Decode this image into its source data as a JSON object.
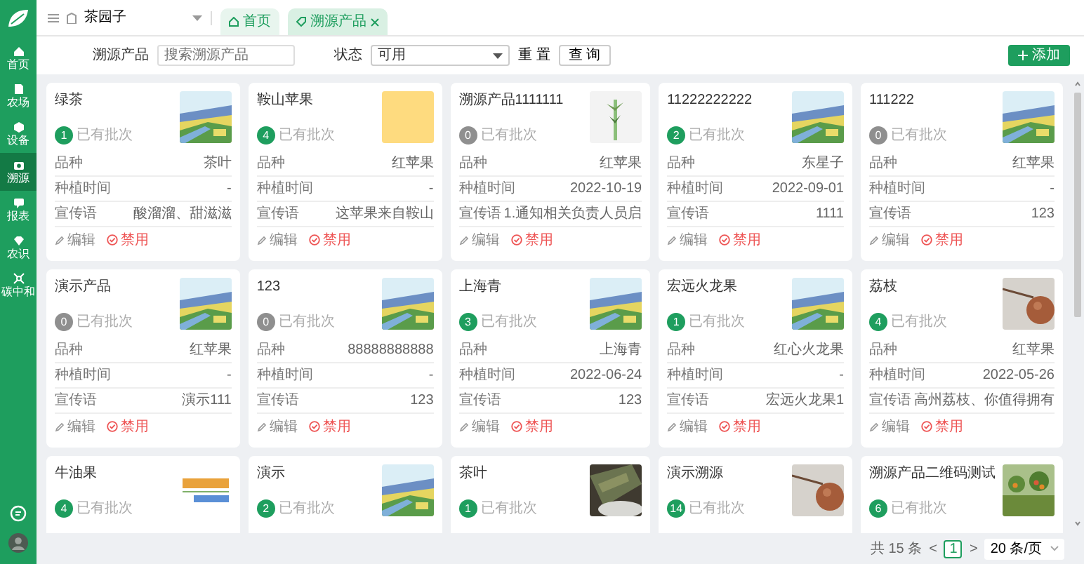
{
  "sidebar": {
    "items": [
      {
        "label": "首页",
        "selected": false
      },
      {
        "label": "农场",
        "selected": false
      },
      {
        "label": "设备",
        "selected": false
      },
      {
        "label": "溯源",
        "selected": true
      },
      {
        "label": "报表",
        "selected": false
      },
      {
        "label": "农识",
        "selected": false
      },
      {
        "label": "碳中和",
        "selected": false
      }
    ]
  },
  "header": {
    "farm_select": "茶园子",
    "tabs": [
      {
        "label": "首页",
        "selected": false,
        "closable": false
      },
      {
        "label": "溯源产品",
        "selected": true,
        "closable": true
      }
    ]
  },
  "filter": {
    "product_label": "溯源产品",
    "product_placeholder": "搜索溯源产品",
    "status_label": "状态",
    "status_value": "可用",
    "reset": "重 置",
    "query": "查 询",
    "add": "添加"
  },
  "cards": [
    {
      "title": "绿茶",
      "count": "1",
      "active": true,
      "count_label": "已有批次",
      "fields": [
        {
          "label": "品种",
          "value": "茶叶"
        },
        {
          "label": "种植时间",
          "value": "-"
        },
        {
          "label": "宣传语",
          "value": "酸溜溜、甜滋滋"
        }
      ],
      "actions": [
        "编辑",
        "禁用"
      ]
    },
    {
      "title": "鞍山苹果",
      "count": "4",
      "active": true,
      "count_label": "已有批次",
      "fields": [
        {
          "label": "品种",
          "value": "红苹果"
        },
        {
          "label": "种植时间",
          "value": "-"
        },
        {
          "label": "宣传语",
          "value": "这苹果来自鞍山"
        }
      ],
      "actions": [
        "编辑",
        "禁用"
      ]
    },
    {
      "title": "溯源产品1111111",
      "count": "0",
      "active": false,
      "count_label": "已有批次",
      "fields": [
        {
          "label": "品种",
          "value": "红苹果"
        },
        {
          "label": "种植时间",
          "value": "2022-10-19"
        },
        {
          "label": "宣传语",
          "value": "1.通知相关负责人员启"
        }
      ],
      "actions": [
        "编辑",
        "禁用"
      ]
    },
    {
      "title": "11222222222",
      "count": "2",
      "active": true,
      "count_label": "已有批次",
      "fields": [
        {
          "label": "品种",
          "value": "东星子"
        },
        {
          "label": "种植时间",
          "value": "2022-09-01"
        },
        {
          "label": "宣传语",
          "value": "1111"
        }
      ],
      "actions": [
        "编辑",
        "禁用"
      ]
    },
    {
      "title": "111222",
      "count": "0",
      "active": false,
      "count_label": "已有批次",
      "fields": [
        {
          "label": "品种",
          "value": "红苹果"
        },
        {
          "label": "种植时间",
          "value": "-"
        },
        {
          "label": "宣传语",
          "value": "123"
        }
      ],
      "actions": [
        "编辑",
        "禁用"
      ]
    },
    {
      "title": "演示产品",
      "count": "0",
      "active": false,
      "count_label": "已有批次",
      "fields": [
        {
          "label": "品种",
          "value": "红苹果"
        },
        {
          "label": "种植时间",
          "value": "-"
        },
        {
          "label": "宣传语",
          "value": "演示111"
        }
      ],
      "actions": [
        "编辑",
        "禁用"
      ]
    },
    {
      "title": "123",
      "count": "0",
      "active": false,
      "count_label": "已有批次",
      "fields": [
        {
          "label": "品种",
          "value": "88888888888"
        },
        {
          "label": "种植时间",
          "value": "-"
        },
        {
          "label": "宣传语",
          "value": "123"
        }
      ],
      "actions": [
        "编辑",
        "禁用"
      ]
    },
    {
      "title": "上海青",
      "count": "3",
      "active": true,
      "count_label": "已有批次",
      "fields": [
        {
          "label": "品种",
          "value": "上海青"
        },
        {
          "label": "种植时间",
          "value": "2022-06-24"
        },
        {
          "label": "宣传语",
          "value": "123"
        }
      ],
      "actions": [
        "编辑",
        "禁用"
      ]
    },
    {
      "title": "宏远火龙果",
      "count": "1",
      "active": true,
      "count_label": "已有批次",
      "fields": [
        {
          "label": "品种",
          "value": "红心火龙果"
        },
        {
          "label": "种植时间",
          "value": "-"
        },
        {
          "label": "宣传语",
          "value": "宏远火龙果1"
        }
      ],
      "actions": [
        "编辑",
        "禁用"
      ]
    },
    {
      "title": "荔枝",
      "count": "4",
      "active": true,
      "count_label": "已有批次",
      "fields": [
        {
          "label": "品种",
          "value": "红苹果"
        },
        {
          "label": "种植时间",
          "value": "2022-05-26"
        },
        {
          "label": "宣传语",
          "value": "高州荔枝、你值得拥有"
        }
      ],
      "actions": [
        "编辑",
        "禁用"
      ]
    },
    {
      "title": "牛油果",
      "count": "4",
      "active": true,
      "count_label": "已有批次"
    },
    {
      "title": "演示",
      "count": "2",
      "active": true,
      "count_label": "已有批次"
    },
    {
      "title": "茶叶",
      "count": "1",
      "active": true,
      "count_label": "已有批次"
    },
    {
      "title": "演示溯源",
      "count": "14",
      "active": true,
      "count_label": "已有批次"
    },
    {
      "title": "溯源产品二维码测试",
      "count": "6",
      "active": true,
      "count_label": "已有批次"
    }
  ],
  "pagination": {
    "total": "共 15 条",
    "prev": "<",
    "pages": [
      {
        "label": "1",
        "selected": true
      }
    ],
    "next": ">",
    "page_size": "20 条/页"
  }
}
